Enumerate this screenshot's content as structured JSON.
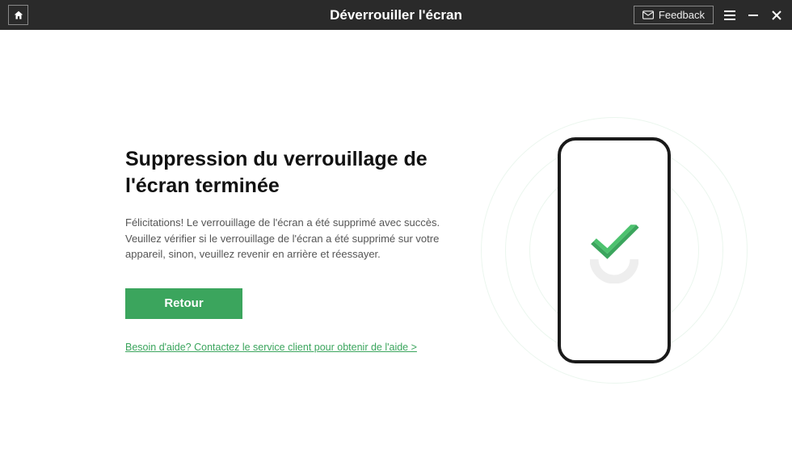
{
  "header": {
    "title": "Déverrouiller l'écran",
    "feedback_label": "Feedback"
  },
  "main": {
    "heading": "Suppression du verrouillage de l'écran terminée",
    "description": "Félicitations! Le verrouillage de l'écran a été supprimé avec succès. Veuillez vérifier si le verrouillage de l'écran a été supprimé sur votre appareil, sinon, veuillez revenir en arrière et réessayer.",
    "back_label": "Retour",
    "help_link": "Besoin d'aide? Contactez le service client pour obtenir de l'aide >"
  },
  "colors": {
    "accent": "#3ba55d",
    "titlebar": "#2a2a2a"
  },
  "icons": {
    "home": "home-icon",
    "mail": "mail-icon",
    "menu": "menu-icon",
    "minimize": "minimize-icon",
    "close": "close-icon",
    "check": "check-icon"
  }
}
